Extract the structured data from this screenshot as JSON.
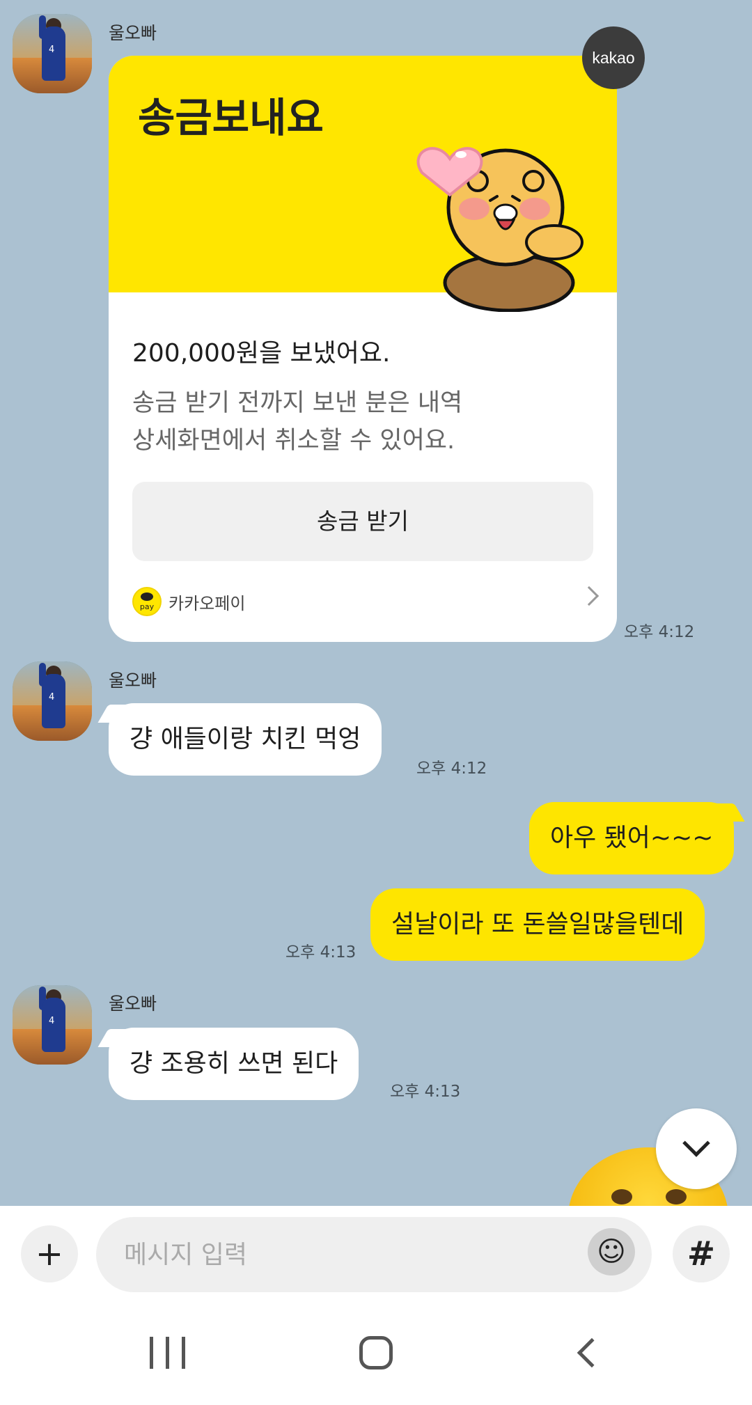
{
  "messages": {
    "sender_name": "울오빠",
    "pay_card": {
      "title": "송금보내요",
      "amount_text": "200,000원을 보냈어요.",
      "sub_line1": "송금 받기 전까지 보낸 분은 내역",
      "sub_line2": "상세화면에서 취소할 수 있어요.",
      "button_label": "송금 받기",
      "brand_label": "카카오페이",
      "logo_text": "pay",
      "badge": "kakao",
      "time": "오후 4:12"
    },
    "msg1": {
      "text": "걍 애들이랑 치킨 먹엉",
      "time": "오후 4:12"
    },
    "msg2": {
      "text": "아우 됐어~~~"
    },
    "msg3": {
      "text": "설날이라 또 돈쓸일많을텐데",
      "time": "오후 4:13"
    },
    "msg4": {
      "text": "걍 조용히 쓰면 된다",
      "time": "오후 4:13"
    }
  },
  "input_bar": {
    "placeholder": "메시지 입력",
    "plus_icon": "+",
    "hash_icon": "#",
    "emoji_icon": "☺"
  },
  "colors": {
    "background": "#abc1d1",
    "my_bubble": "#fee500",
    "pay_yellow": "#ffe600"
  }
}
